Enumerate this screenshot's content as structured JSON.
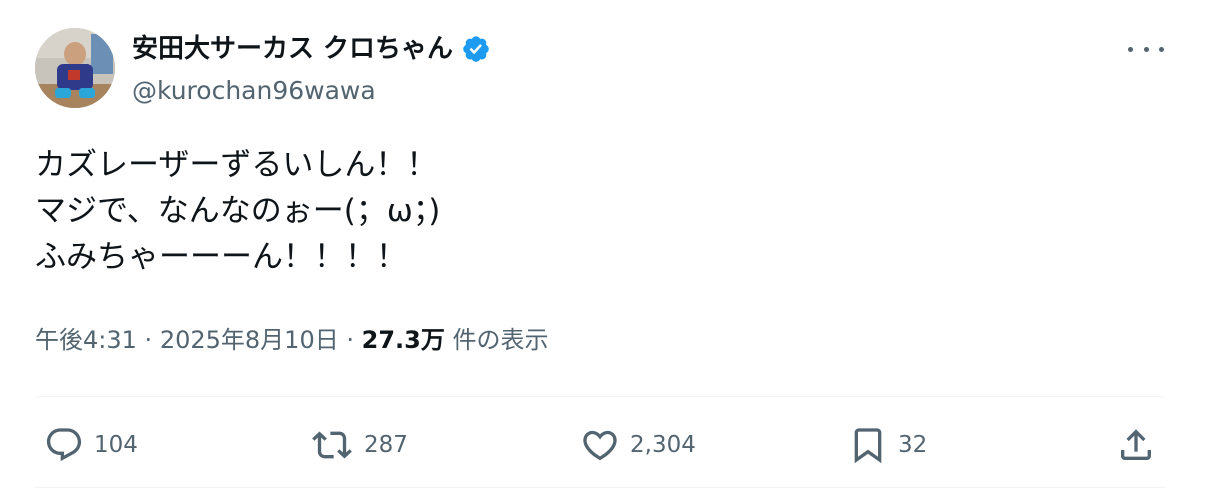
{
  "author": {
    "display_name": "安田大サーカス クロちゃん",
    "handle": "@kurochan96wawa",
    "verified": true,
    "verified_color": "#1d9bf0"
  },
  "tweet": {
    "lines": [
      "カズレーザーずるいしん！！",
      "マジで、なんなのぉー(；ω；)",
      "ふみちゃーーーん！！！！"
    ]
  },
  "meta": {
    "time": "午後4:31",
    "separator": "·",
    "date": "2025年8月10日",
    "views_count": "27.3万",
    "views_label": "件の表示"
  },
  "actions": {
    "replies": "104",
    "reposts": "287",
    "likes": "2,304",
    "bookmarks": "32"
  },
  "icons": {
    "more": "more-icon",
    "reply": "reply-icon",
    "repost": "repost-icon",
    "like": "heart-icon",
    "bookmark": "bookmark-icon",
    "share": "share-icon",
    "verified": "verified-badge-icon"
  },
  "colors": {
    "text_primary": "#0f1419",
    "text_secondary": "#536471",
    "divider": "#eff3f4",
    "accent": "#1d9bf0"
  }
}
